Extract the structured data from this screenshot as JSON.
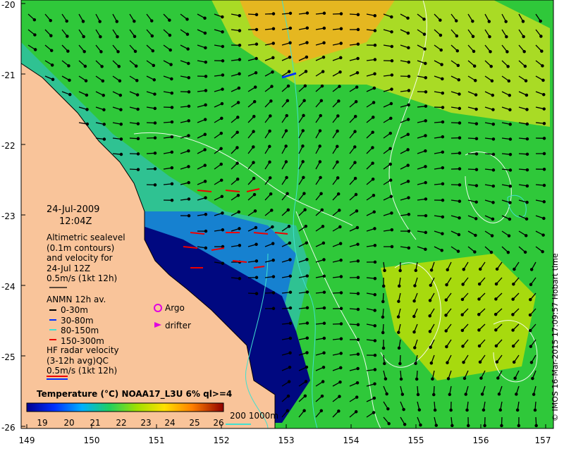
{
  "map": {
    "lat_labels": [
      "-20",
      "-21",
      "-22",
      "-23",
      "-24",
      "-25",
      "-26"
    ],
    "lon_labels": [
      "149",
      "150",
      "151",
      "152",
      "153",
      "154",
      "155",
      "156",
      "157"
    ],
    "date": "24-Jul-2009",
    "time": "12:04Z",
    "altimetry_text": [
      "Altimetric sealevel",
      "(0.1m contours)",
      "and velocity for",
      "24-Jul 12Z",
      "0.5m/s (1kt 12h)"
    ],
    "anmn_title": "ANMN 12h av.",
    "anmn_depths": [
      "0-30m",
      "30-80m",
      "80-150m",
      "150-300m"
    ],
    "argo_label": "Argo",
    "drifter_label": "drifter",
    "hf_text": [
      "HF radar velocity",
      "(3-12h avg)QC",
      "0.5m/s (1kt 12h)"
    ],
    "colorbar_title": "Temperature (°C) NOAA17_L3U 6% ql>=4",
    "colorbar_ticks": [
      "19",
      "20",
      "21",
      "22",
      "23",
      "24",
      "25",
      "26"
    ],
    "contour_legend": "200  1000m",
    "credit": "© IMOS 16-Mar-2015 17:09:57 Hobart time"
  },
  "colors": {
    "land": "#f9c49a",
    "coast_dark": "#000066",
    "contour_white": "#ffffff",
    "contour_cyan": "#40e0d0"
  }
}
